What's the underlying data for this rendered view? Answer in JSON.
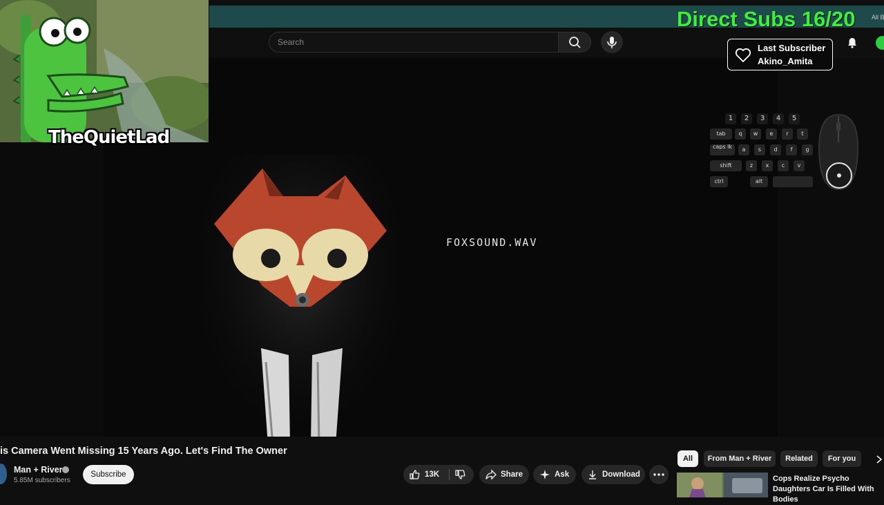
{
  "header": {
    "search_placeholder": "Search",
    "icons": [
      "search-icon",
      "mic-icon",
      "bell-icon"
    ]
  },
  "video": {
    "caption": "FOXSOUND.WAV"
  },
  "overlay": {
    "webcam_name": "TheQuietLad",
    "subs_goal": "Direct Subs 16/20",
    "subs_tiny": "All B",
    "last_subscriber_label": "Last Subscriber",
    "last_subscriber_name": "Akino_Amita",
    "keys": {
      "row1": [
        "1",
        "2",
        "3",
        "4",
        "5"
      ],
      "row2": [
        "tab",
        "q",
        "w",
        "e",
        "r",
        "t"
      ],
      "row3": [
        "caps lk",
        "a",
        "s",
        "d",
        "f",
        "g"
      ],
      "row4": [
        "shift",
        "z",
        "x",
        "c",
        "v"
      ],
      "row5": [
        "ctrl",
        "alt",
        ""
      ]
    },
    "accent_color": "#3cf03c"
  },
  "watch": {
    "title": "is Camera Went Missing 15 Years Ago. Let's Find The Owner",
    "channel_name": "Man + River",
    "channel_subs": "5.85M subscribers",
    "subscribe_label": "Subscribe",
    "like_count": "13K",
    "share_label": "Share",
    "ask_label": "Ask",
    "download_label": "Download"
  },
  "related": {
    "chips": [
      "All",
      "From Man + River",
      "Related",
      "For you"
    ],
    "active_chip": "All",
    "first_video_title": "Cops Realize Psycho Daughters Car Is Filled With Bodies"
  }
}
